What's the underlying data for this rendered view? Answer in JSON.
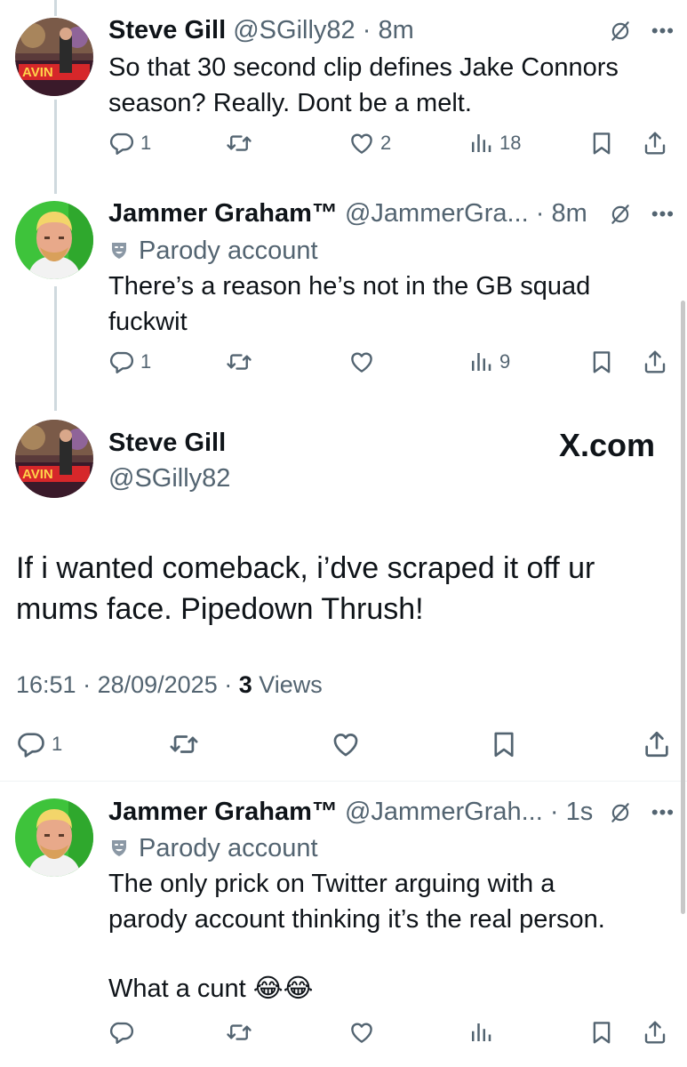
{
  "tweets": [
    {
      "name": "Steve Gill",
      "handle": "@SGilly82",
      "dot": " · ",
      "time": "8m",
      "text_lines": [
        "So that 30 second clip defines Jake Connors",
        "season? Really. Dont be a melt."
      ],
      "replies": "1",
      "reposts": "",
      "likes": "2",
      "views": "18"
    },
    {
      "name": "Jammer Graham™",
      "handle": "@JammerGra...",
      "dot": " · ",
      "time": "8m",
      "parody_label": "Parody account",
      "text_lines": [
        "There’s a reason he’s not in the GB squad",
        "fuckwit"
      ],
      "replies": "1",
      "reposts": "",
      "likes": "",
      "views": "9"
    }
  ],
  "main_tweet": {
    "name": "Steve Gill",
    "handle": "@SGilly82",
    "brand": "X.com",
    "text_lines": [
      "If i wanted comeback, i’dve scraped it off ur",
      "mums face. Pipedown Thrush!"
    ],
    "time": "16:51",
    "date": "28/09/2025",
    "sep": " · ",
    "views_count": "3",
    "views_label": " Views",
    "replies": "1"
  },
  "reply": {
    "name": "Jammer Graham™",
    "handle": "@JammerGrah...",
    "dot": " · ",
    "time": "1s",
    "parody_label": "Parody account",
    "text_lines": [
      "The only prick on Twitter arguing with a",
      "parody account thinking it’s the real person."
    ],
    "text_line3": "What a cunt 😂😂"
  },
  "icons": {
    "reply": "reply-icon",
    "repost": "repost-icon",
    "like": "heart-icon",
    "views": "views-icon",
    "bookmark": "bookmark-icon",
    "share": "share-icon",
    "grok": "grok-icon",
    "more": "more-icon"
  },
  "colors": {
    "text": "#0f1419",
    "secondary": "#536471",
    "thread_line": "#cfd9de",
    "divider": "#eff3f4"
  }
}
